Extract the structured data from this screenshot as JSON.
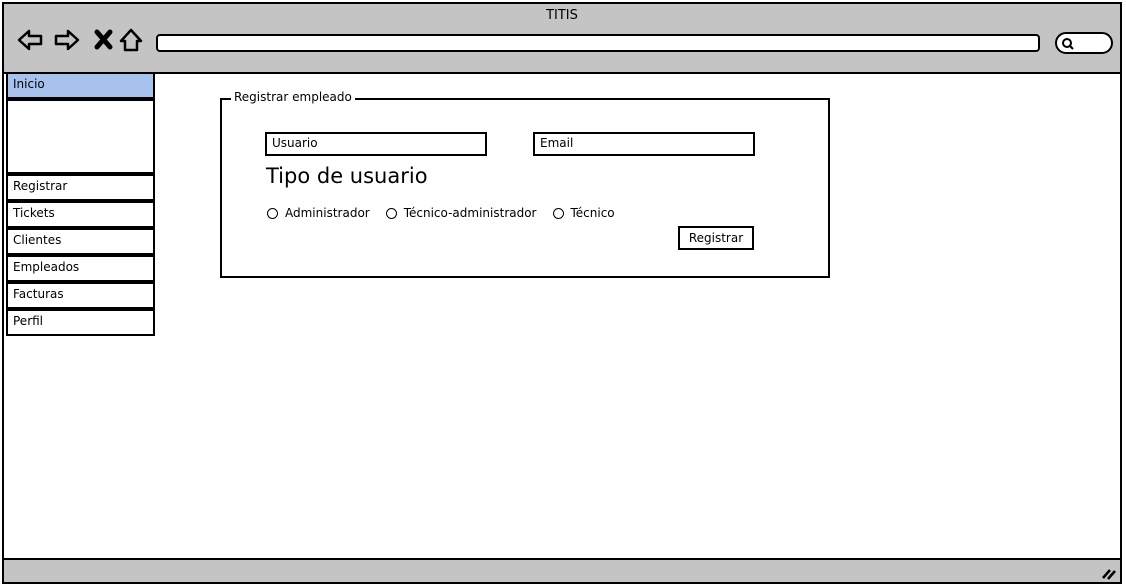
{
  "window": {
    "title": "TITIS"
  },
  "toolbar": {
    "back_icon": "back-arrow-icon",
    "forward_icon": "forward-arrow-icon",
    "stop_icon": "close-icon",
    "home_icon": "home-icon",
    "search_icon": "search-icon",
    "url_value": ""
  },
  "sidebar": {
    "items": [
      {
        "label": "Inicio",
        "active": true
      },
      {
        "label": "Registrar",
        "active": false
      },
      {
        "label": "Tickets",
        "active": false
      },
      {
        "label": "Clientes",
        "active": false
      },
      {
        "label": "Empleados",
        "active": false
      },
      {
        "label": "Facturas",
        "active": false
      },
      {
        "label": "Perfil",
        "active": false
      }
    ]
  },
  "form": {
    "legend": "Registrar empleado",
    "user_placeholder": "Usuario",
    "email_placeholder": "Email",
    "type_heading": "Tipo de usuario",
    "radios": [
      "Administrador",
      "Técnico-administrador",
      "Técnico"
    ],
    "submit_label": "Registrar"
  },
  "colors": {
    "chrome": "#c4c4c4",
    "active_item": "#a8c2ee"
  }
}
